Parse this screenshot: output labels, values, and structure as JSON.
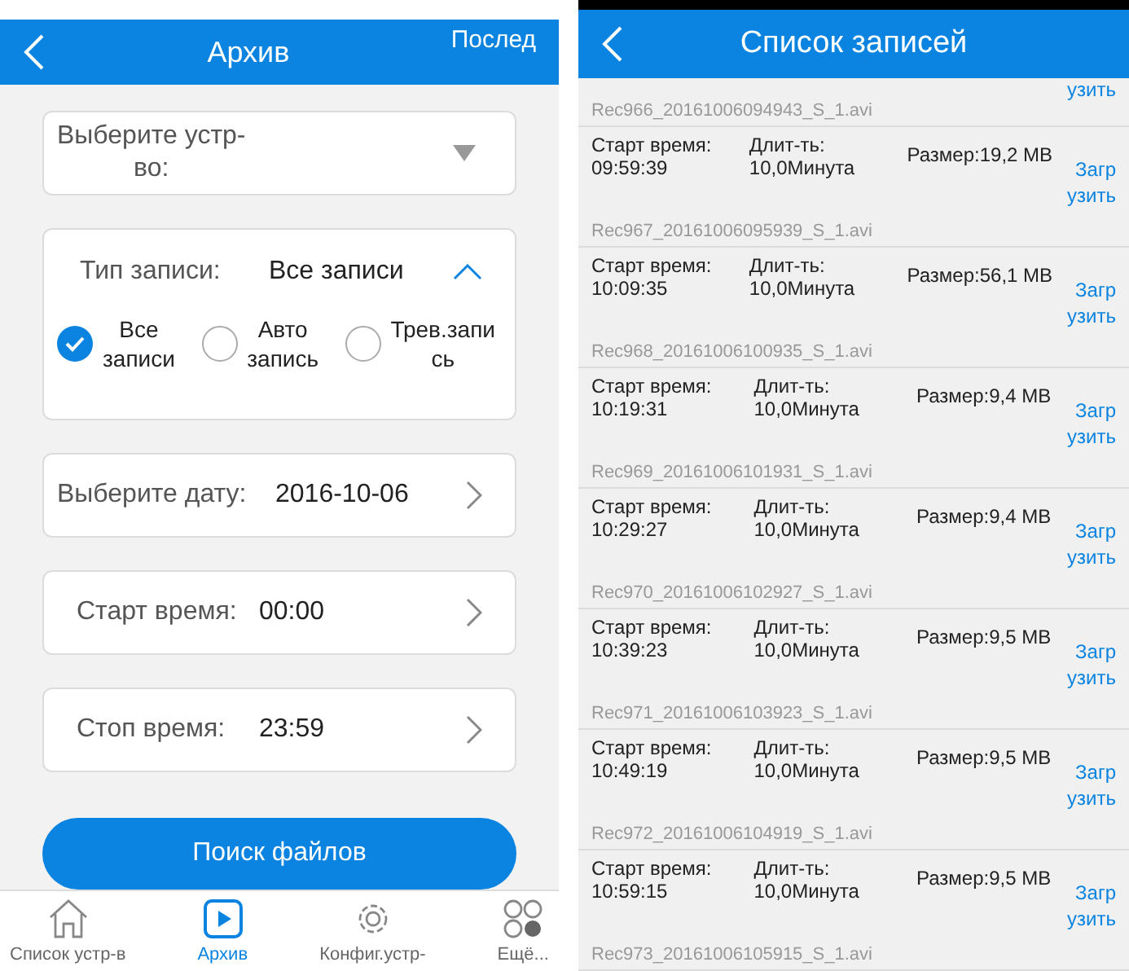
{
  "left_screen": {
    "header": {
      "title": "Архив",
      "right_action": "Послед"
    },
    "device_select": {
      "label": "Выберите устр-\nво:"
    },
    "record_type": {
      "label": "Тип записи:",
      "value": "Все записи",
      "expanded": true,
      "options": [
        {
          "label": "Все\nзаписи",
          "selected": true
        },
        {
          "label": "Авто\nзапись",
          "selected": false
        },
        {
          "label": "Трев.запи\nсь",
          "selected": false
        }
      ]
    },
    "fields": [
      {
        "label": "Выберите дату:",
        "value": "2016-10-06"
      },
      {
        "label": "Старт время:",
        "value": "00:00"
      },
      {
        "label": "Стоп время:",
        "value": "23:59"
      }
    ],
    "search_button": "Поиск файлов",
    "bottom_nav": [
      {
        "kind": "home",
        "label": "Список устр-в",
        "selected": false
      },
      {
        "kind": "play",
        "label": "Архив",
        "selected": true
      },
      {
        "kind": "gear",
        "label": "Конфиг.устр-",
        "selected": false
      },
      {
        "kind": "more",
        "label": "Ещё...",
        "selected": false
      }
    ]
  },
  "right_screen": {
    "header": {
      "title": "Список записей"
    },
    "records": [
      {
        "kind": "partial",
        "download": "узить",
        "filename": "Rec966_20161006094943_S_1.avi"
      },
      {
        "kind": "full",
        "start_label": "Старт время:",
        "start": "09:59:39",
        "duration_label": "Длит-ть:",
        "duration": "10,0Минута",
        "size": "Размер:19,2 MB",
        "download": "Загр\nузить",
        "filename": "Rec967_20161006095939_S_1.avi"
      },
      {
        "kind": "full",
        "start_label": "Старт время:",
        "start": "10:09:35",
        "duration_label": "Длит-ть:",
        "duration": "10,0Минута",
        "size": "Размер:56,1 MB",
        "download": "Загр\nузить",
        "filename": "Rec968_20161006100935_S_1.avi"
      },
      {
        "kind": "full",
        "start_label": "Старт время:",
        "start": "10:19:31",
        "duration_label": "Длит-ть:",
        "duration": "10,0Минута",
        "size": "Размер:9,4 MB",
        "download": "Загр\nузить",
        "filename": "Rec969_20161006101931_S_1.avi"
      },
      {
        "kind": "full",
        "start_label": "Старт время:",
        "start": "10:29:27",
        "duration_label": "Длит-ть:",
        "duration": "10,0Минута",
        "size": "Размер:9,4 MB",
        "download": "Загр\nузить",
        "filename": "Rec970_20161006102927_S_1.avi"
      },
      {
        "kind": "full",
        "start_label": "Старт время:",
        "start": "10:39:23",
        "duration_label": "Длит-ть:",
        "duration": "10,0Минута",
        "size": "Размер:9,5 MB",
        "download": "Загр\nузить",
        "filename": "Rec971_20161006103923_S_1.avi"
      },
      {
        "kind": "full",
        "start_label": "Старт время:",
        "start": "10:49:19",
        "duration_label": "Длит-ть:",
        "duration": "10,0Минута",
        "size": "Размер:9,5 MB",
        "download": "Загр\nузить",
        "filename": "Rec972_20161006104919_S_1.avi"
      },
      {
        "kind": "full",
        "start_label": "Старт время:",
        "start": "10:59:15",
        "duration_label": "Длит-ть:",
        "duration": "10,0Минута",
        "size": "Размер:9,5 MB",
        "download": "Загр\nузить",
        "filename": "Rec973_20161006105915_S_1.avi"
      }
    ]
  }
}
